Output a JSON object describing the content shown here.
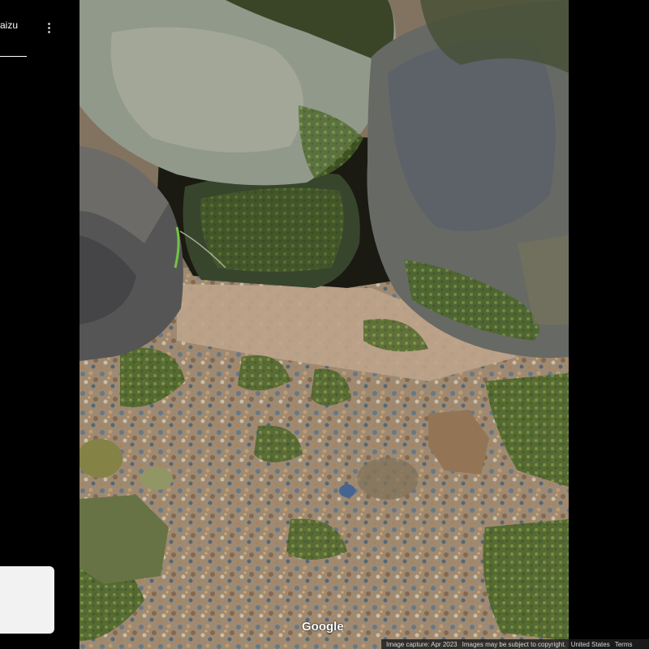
{
  "panel": {
    "place_name": "aizu",
    "more_options_icon": "more-vert-icon"
  },
  "map": {
    "watermark": "Google"
  },
  "footer": {
    "capture": "Image capture: Apr 2023",
    "copyright": "Images may be subject to copyright.",
    "region": "United States",
    "terms": "Terms"
  },
  "colors": {
    "panel_bg": "#000000",
    "text": "#ffffff",
    "minimap_bg": "#f2f2f2"
  }
}
